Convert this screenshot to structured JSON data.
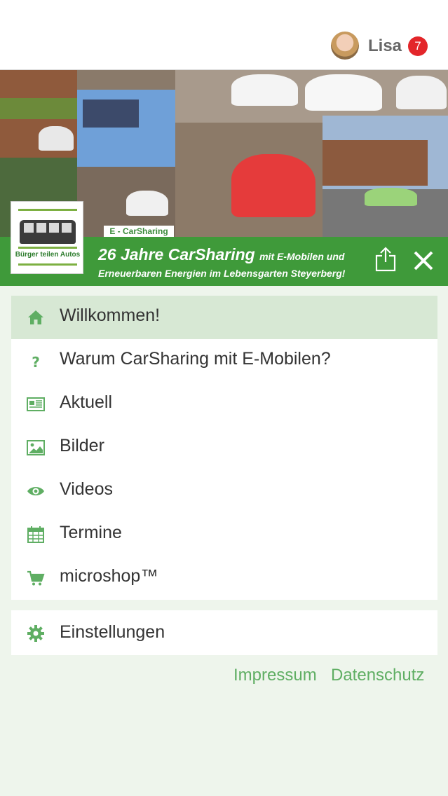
{
  "user": {
    "name": "Lisa",
    "notification_count": "7",
    "avatar_icon": "user-avatar"
  },
  "banner": {
    "caption": "E - CarSharing"
  },
  "logo": {
    "text": "Bürger teilen Autos"
  },
  "title": {
    "line1_main": "26 Jahre CarSharing",
    "line1_sub": "mit E-Mobilen und",
    "line2": "Erneuerbaren Energien im Lebensgarten Steyerberg!"
  },
  "colors": {
    "brand_green": "#3f9a3a",
    "icon_green": "#5fae63",
    "active_bg": "#d7e8d4",
    "badge_red": "#e3262a"
  },
  "menu": {
    "items": [
      {
        "label": "Willkommen!",
        "icon": "home-icon",
        "active": true
      },
      {
        "label": "Warum CarSharing mit E-Mobilen?",
        "icon": "question-icon"
      },
      {
        "label": "Aktuell",
        "icon": "newspaper-icon"
      },
      {
        "label": "Bilder",
        "icon": "image-icon"
      },
      {
        "label": "Videos",
        "icon": "eye-icon"
      },
      {
        "label": "Termine",
        "icon": "calendar-icon"
      },
      {
        "label": "microshop™",
        "icon": "cart-icon"
      }
    ],
    "settings_label": "Einstellungen"
  },
  "footer": {
    "impressum": "Impressum",
    "datenschutz": "Datenschutz"
  }
}
